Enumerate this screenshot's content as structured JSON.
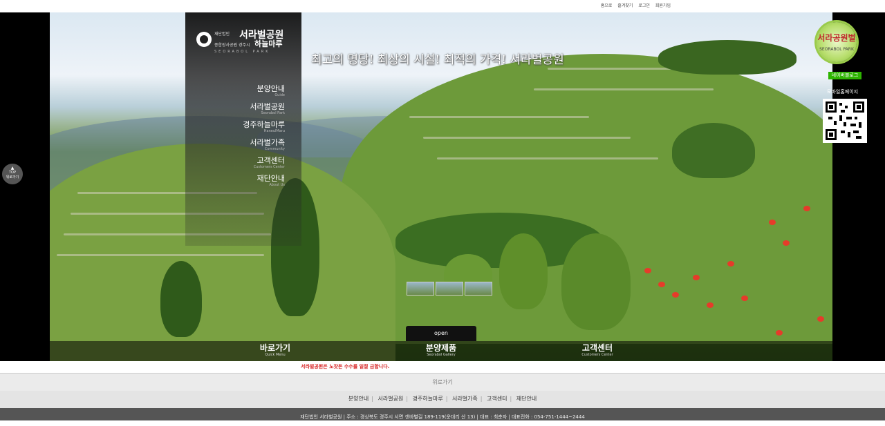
{
  "top_links": [
    "홈으로",
    "즐겨찾기",
    "로그인",
    "회원가입"
  ],
  "logo": {
    "small": "재단법인",
    "name": "서라벌공원",
    "sub": "종합장사공원 경주시",
    "name2": "하늘마루",
    "en": "SEORABOL PARK"
  },
  "menu": [
    {
      "ko": "분양안내",
      "en": "Guide"
    },
    {
      "ko": "서라벌공원",
      "en": "Seorabol Park"
    },
    {
      "ko": "경주하늘마루",
      "en": "HaneulMaru"
    },
    {
      "ko": "서라벌가족",
      "en": "Community"
    },
    {
      "ko": "고객센터",
      "en": "Customers Center"
    },
    {
      "ko": "재단안내",
      "en": "About Us"
    }
  ],
  "headline": "최고의 명당! 최상의 시설! 최적의 가격! 서라벌공원",
  "top_button": {
    "label": "TOP",
    "sub": "위로가기"
  },
  "badge": {
    "title": "서라공원벌",
    "sub": "SEORABOL PARK"
  },
  "naver_blog": "네이버블로그",
  "mobile_label": "모바일홈페이지",
  "open_label": "open",
  "bottom_menu": [
    {
      "ko": "바로가기",
      "en": "Quick Menu"
    },
    {
      "ko": "분양제품",
      "en": "Seorabol Gallery"
    },
    {
      "ko": "고객센터",
      "en": "Customers Center"
    }
  ],
  "notice": "서라벌공원은 노잣돈 수수를 일절 금합니다.",
  "go_top": "위로가기",
  "footer_nav": [
    "분양안내",
    "서라벌공원",
    "경주하늘마루",
    "서라벌가족",
    "고객센터",
    "재단안내"
  ],
  "footer_info": "재단법인 서라벌공원 | 주소 : 경상북도 경주시 서면 갠바별길 189-119(운대리 산 13) | 대표 : 최춘자 | 대표전화 : 054-751-1444~2444",
  "colors": {
    "notice": "#d62020",
    "naver": "#2db400",
    "footer": "#555555"
  }
}
